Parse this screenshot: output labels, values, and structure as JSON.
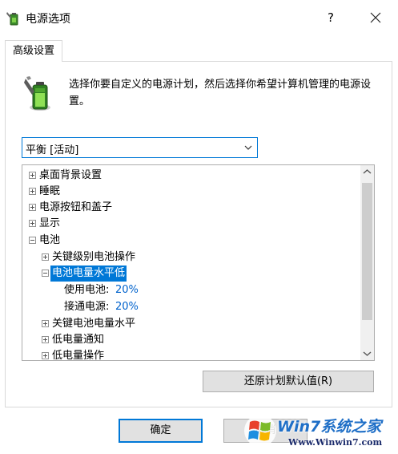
{
  "window": {
    "title": "电源选项",
    "help_label": "?",
    "close_label": "✕"
  },
  "tabs": [
    {
      "label": "高级设置",
      "active": true
    }
  ],
  "description": "选择你要自定义的电源计划，然后选择你希望计算机管理的电源设置。",
  "plan_select": {
    "value": "平衡 [活动]"
  },
  "tree": {
    "items": [
      {
        "label": "桌面背景设置",
        "expander": "plus"
      },
      {
        "label": "睡眠",
        "expander": "plus"
      },
      {
        "label": "电源按钮和盖子",
        "expander": "plus"
      },
      {
        "label": "显示",
        "expander": "plus"
      },
      {
        "label": "电池",
        "expander": "minus"
      },
      {
        "label": "关键级别电池操作",
        "expander": "plus"
      },
      {
        "label": "电池电量水平低",
        "expander": "minus",
        "selected": true
      },
      {
        "label": "使用电池:",
        "value": "20%"
      },
      {
        "label": "接通电源:",
        "value": "20%"
      },
      {
        "label": "关键电池电量水平",
        "expander": "plus"
      },
      {
        "label": "低电量通知",
        "expander": "plus"
      },
      {
        "label": "低电量操作",
        "expander": "plus"
      }
    ]
  },
  "buttons": {
    "restore_defaults": "还原计划默认值(R)",
    "ok": "确定",
    "cancel": "取消"
  },
  "watermark": {
    "brand": "Win7系统之家",
    "url": "Www.Winwin7.com"
  },
  "colors": {
    "accent": "#0078d7",
    "value_blue": "#0062cc",
    "button_face": "#e1e1e1"
  }
}
